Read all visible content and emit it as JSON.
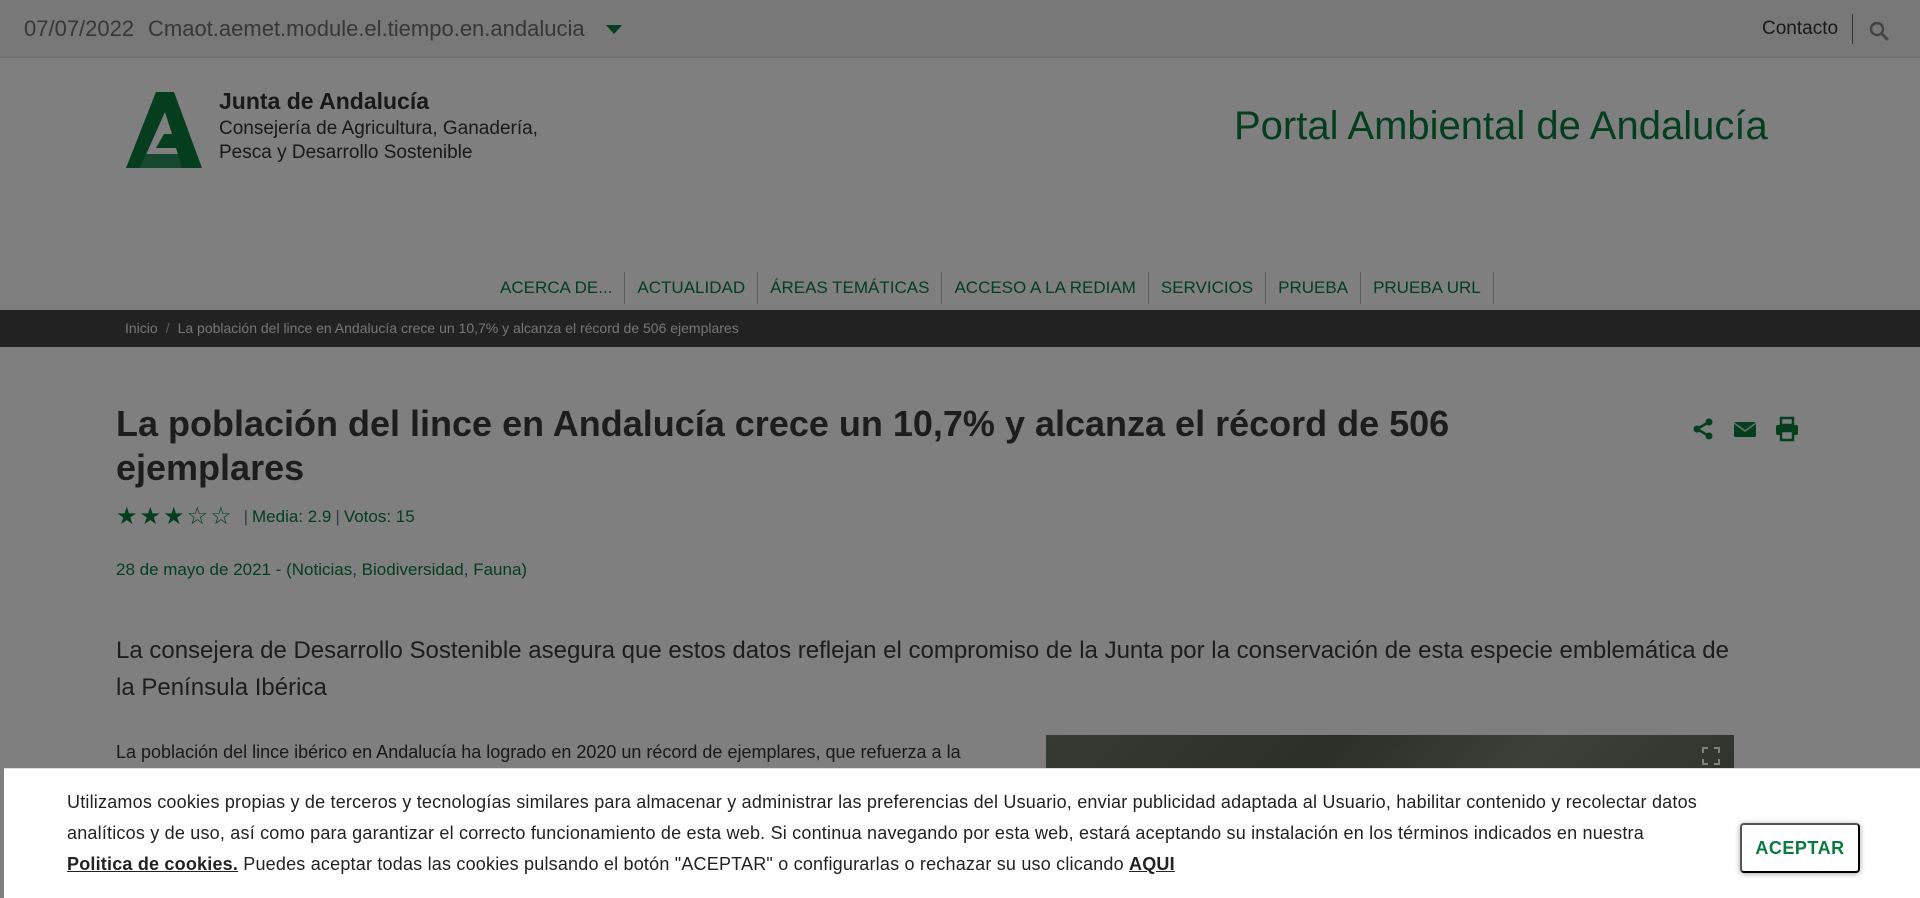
{
  "topbar": {
    "date": "07/07/2022",
    "module": "Cmaot.aemet.module.el.tiempo.en.andalucia",
    "contact": "Contacto"
  },
  "header": {
    "brand_title": "Junta de Andalucía",
    "brand_sub1": "Consejería de Agricultura, Ganadería,",
    "brand_sub2": "Pesca y Desarrollo Sostenible",
    "portal_title": "Portal Ambiental de Andalucía"
  },
  "nav": {
    "items": [
      "ACERCA DE...",
      "ACTUALIDAD",
      "ÁREAS TEMÁTICAS",
      "ACCESO A LA REDIAM",
      "SERVICIOS",
      "PRUEBA",
      "PRUEBA URL"
    ]
  },
  "breadcrumb": {
    "home": "Inicio",
    "divider": "/",
    "current": "La población del lince en Andalucía crece un 10,7% y alcanza el récord de 506 ejemplares"
  },
  "article": {
    "title": "La población del lince en Andalucía crece un 10,7% y alcanza el récord de 506 ejemplares",
    "rating": {
      "stars_filled": 3,
      "stars_total": 5,
      "average_label": "Media: 2.9",
      "votes_label": "Votos: 15"
    },
    "meta": "28 de mayo de 2021 - (Noticias, Biodiversidad, Fauna)",
    "lead": "La consejera de Desarrollo Sostenible asegura que estos datos reflejan el compromiso de la Junta por la conservación de esta especie emblemática de la Península Ibérica",
    "body_first_line": "La población del lince ibérico en Andalucía ha logrado en 2020 un récord de ejemplares, que refuerza a la"
  },
  "cookie": {
    "text_1": "Utilizamos cookies propias y de terceros y tecnologías similares para almacenar y administrar las preferencias del Usuario, enviar publicidad adaptada al Usuario, habilitar contenido y recolectar datos analíticos y de uso, así como para garantizar el correcto funcionamiento de esta web. Si continua navegando por esta web, estará aceptando su instalación en los términos indicados en nuestra ",
    "policy_link": "Politica de cookies.",
    "text_2": " Puedes aceptar todas las cookies pulsando el botón \"ACEPTAR\" o configurarlas o rechazar su uso clicando ",
    "here_link": "AQUI",
    "accept_label": "ACEPTAR"
  },
  "colors": {
    "accent": "#0b7a3f",
    "breadcrumb_bg": "#444444",
    "topbar_bg": "#f0f0f0"
  }
}
